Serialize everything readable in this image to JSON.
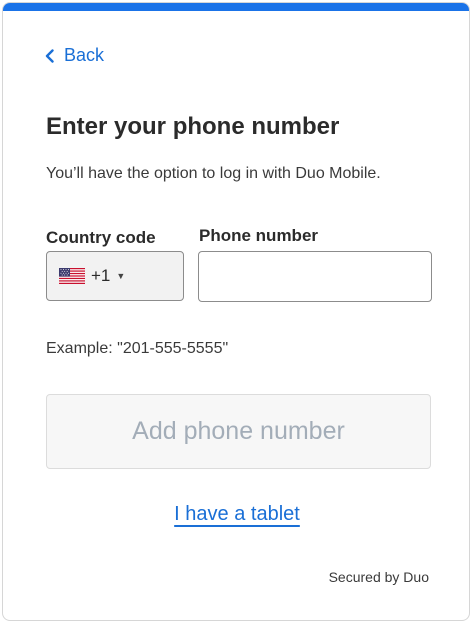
{
  "colors": {
    "accent": "#1a73e8",
    "link": "#1a6fd6",
    "disabled_text": "#a3adb8"
  },
  "nav": {
    "back_label": "Back",
    "back_icon": "chevron-left-icon"
  },
  "header": {
    "title": "Enter your phone number",
    "subtitle": "You’ll have the option to log in with Duo Mobile."
  },
  "form": {
    "country_code_label": "Country code",
    "country_code_value": "+1",
    "country_flag": "us-flag-icon",
    "phone_label": "Phone number",
    "phone_value": "",
    "example_text": "Example: \"201-555-5555\""
  },
  "actions": {
    "add_phone_label": "Add phone number",
    "tablet_link": "I have a tablet"
  },
  "footer": {
    "secured_text": "Secured by Duo"
  }
}
